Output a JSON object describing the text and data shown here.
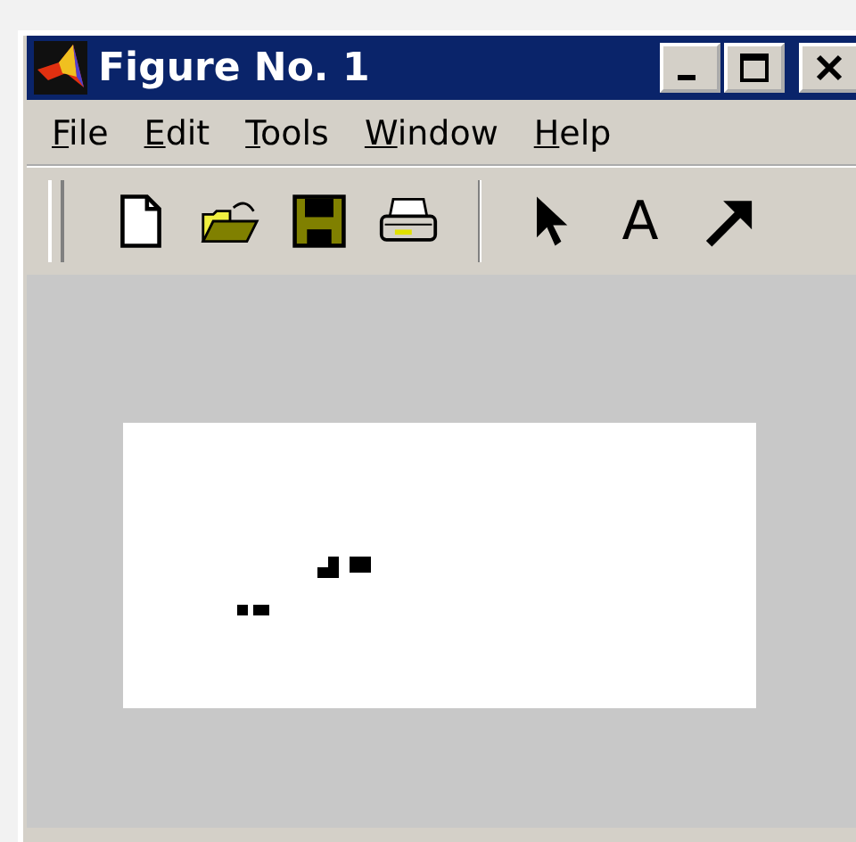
{
  "window": {
    "title": "Figure No. 1"
  },
  "menu": [
    "File",
    "Edit",
    "Tools",
    "Window",
    "Help"
  ],
  "toolbar": [
    {
      "kind": "new"
    },
    {
      "kind": "open"
    },
    {
      "kind": "save"
    },
    {
      "kind": "print"
    },
    {
      "kind": "separator"
    },
    {
      "kind": "pointer"
    },
    {
      "kind": "text",
      "label": "A"
    },
    {
      "kind": "arrow"
    }
  ],
  "axes": {
    "kind": "plot"
  }
}
